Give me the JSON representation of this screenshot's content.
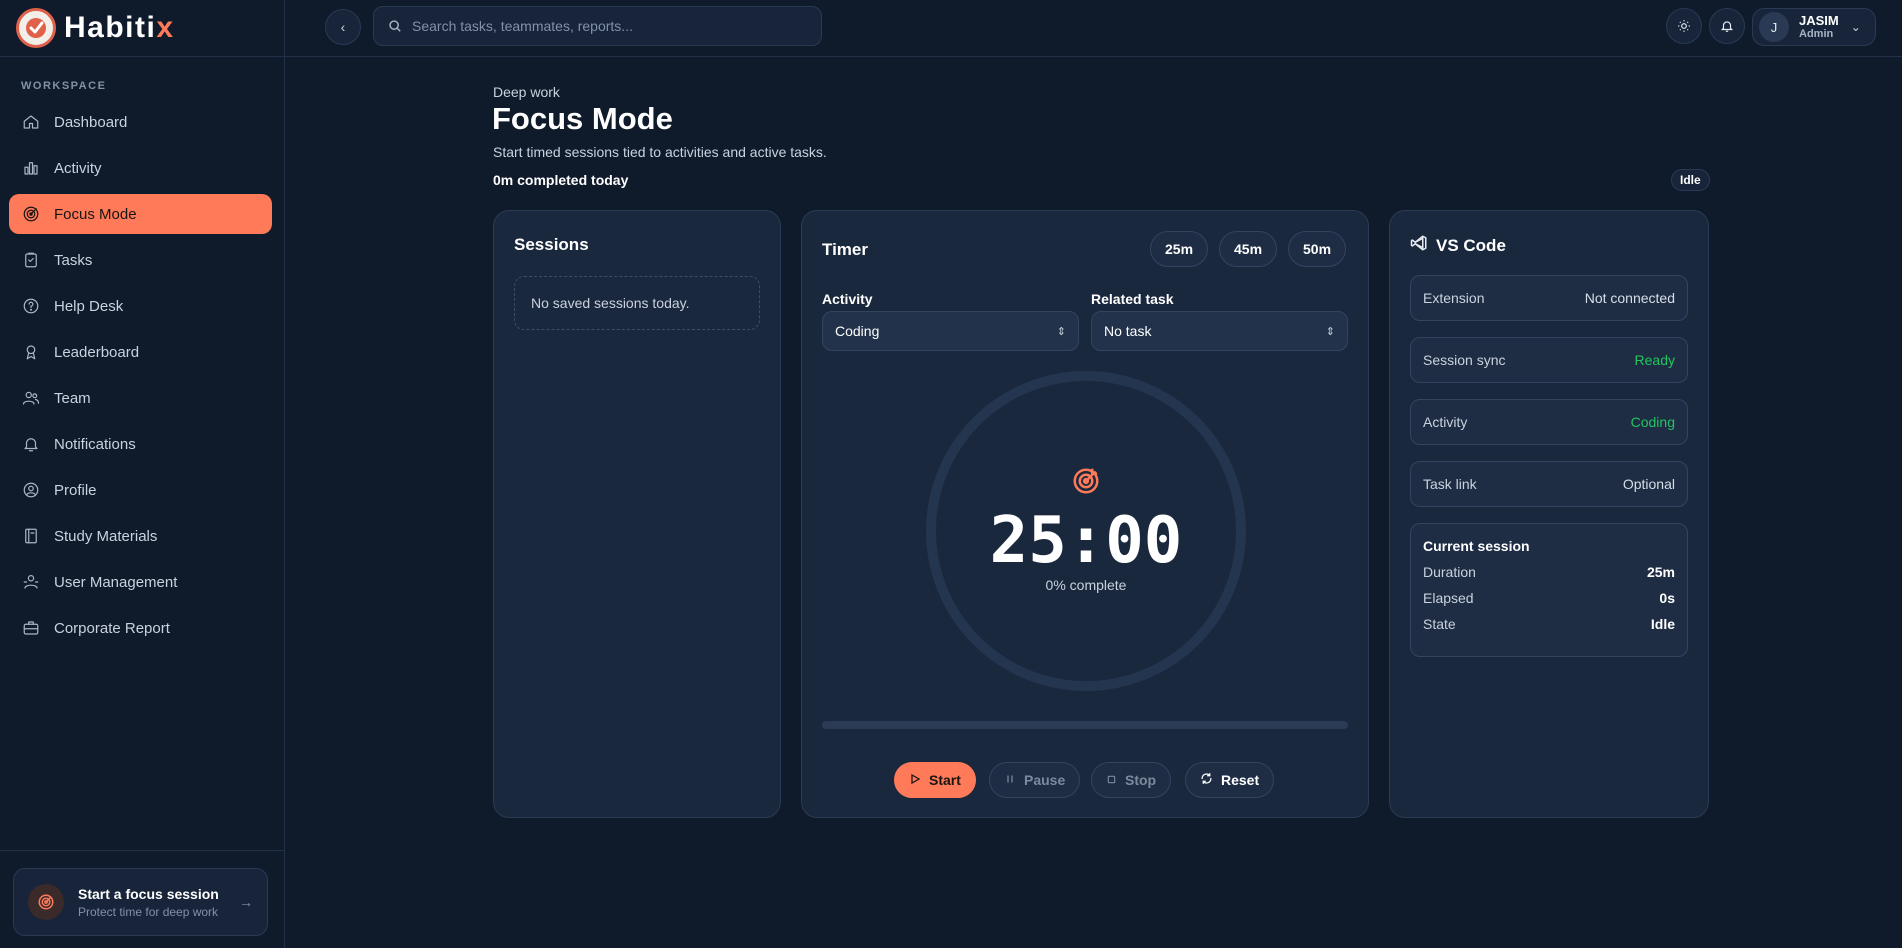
{
  "brand": {
    "name_main": "Habiti",
    "name_accent": "x"
  },
  "sidebar": {
    "section_label": "WORKSPACE",
    "items": [
      {
        "label": "Dashboard",
        "icon": "home-icon"
      },
      {
        "label": "Activity",
        "icon": "bar-chart-icon"
      },
      {
        "label": "Focus Mode",
        "icon": "target-icon",
        "active": true
      },
      {
        "label": "Tasks",
        "icon": "clipboard-icon"
      },
      {
        "label": "Help Desk",
        "icon": "help-circle-icon"
      },
      {
        "label": "Leaderboard",
        "icon": "award-icon"
      },
      {
        "label": "Team",
        "icon": "users-icon"
      },
      {
        "label": "Notifications",
        "icon": "bell-icon"
      },
      {
        "label": "Profile",
        "icon": "user-circle-icon"
      },
      {
        "label": "Study Materials",
        "icon": "book-icon"
      },
      {
        "label": "User Management",
        "icon": "user-cog-icon"
      },
      {
        "label": "Corporate Report",
        "icon": "briefcase-icon"
      }
    ],
    "promo": {
      "title": "Start a focus session",
      "subtitle": "Protect time for deep work"
    }
  },
  "topbar": {
    "search_placeholder": "Search tasks, teammates, reports...",
    "user": {
      "initial": "J",
      "name": "JASIM",
      "role": "Admin"
    }
  },
  "header": {
    "eyebrow": "Deep work",
    "title": "Focus Mode",
    "subtitle": "Start timed sessions tied to activities and active tasks.",
    "completed": "0m completed today",
    "status": "Idle"
  },
  "sessions": {
    "title": "Sessions",
    "empty": "No saved sessions today."
  },
  "timer": {
    "title": "Timer",
    "presets": [
      "25m",
      "45m",
      "50m"
    ],
    "activity_label": "Activity",
    "activity_value": "Coding",
    "task_label": "Related task",
    "task_value": "No task",
    "time": "25:00",
    "percent_text": "0% complete",
    "progress": 0,
    "controls": {
      "start": "Start",
      "pause": "Pause",
      "stop": "Stop",
      "reset": "Reset"
    }
  },
  "vscode": {
    "title": "VS Code",
    "rows": [
      {
        "key": "Extension",
        "value": "Not connected",
        "color": "default"
      },
      {
        "key": "Session sync",
        "value": "Ready",
        "color": "green"
      },
      {
        "key": "Activity",
        "value": "Coding",
        "color": "green"
      },
      {
        "key": "Task link",
        "value": "Optional",
        "color": "default"
      }
    ],
    "current": {
      "title": "Current session",
      "duration_label": "Duration",
      "duration": "25m",
      "elapsed_label": "Elapsed",
      "elapsed": "0s",
      "state_label": "State",
      "state": "Idle"
    }
  },
  "colors": {
    "accent": "#ff7a59",
    "bg": "#0f1a2b",
    "card": "#1a283d",
    "success": "#22c55e"
  }
}
